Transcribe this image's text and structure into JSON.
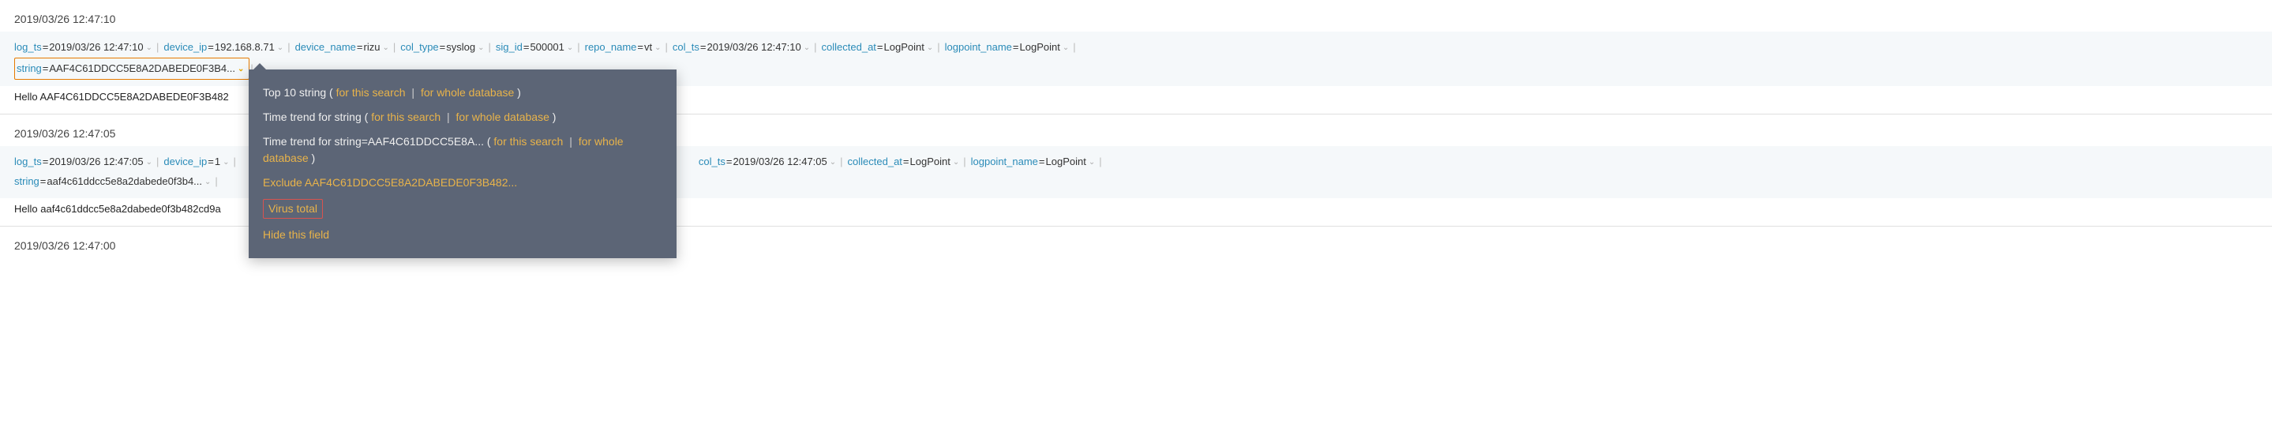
{
  "entries": [
    {
      "timestamp": "2019/03/26 12:47:10",
      "fields": [
        {
          "key": "log_ts",
          "val": "2019/03/26 12:47:10",
          "hl": false
        },
        {
          "key": "device_ip",
          "val": "192.168.8.71",
          "hl": false
        },
        {
          "key": "device_name",
          "val": "rizu",
          "hl": false
        },
        {
          "key": "col_type",
          "val": "syslog",
          "hl": false
        },
        {
          "key": "sig_id",
          "val": "500001",
          "hl": false
        },
        {
          "key": "repo_name",
          "val": "vt",
          "hl": false
        },
        {
          "key": "col_ts",
          "val": "2019/03/26 12:47:10",
          "hl": false
        },
        {
          "key": "collected_at",
          "val": "LogPoint",
          "hl": false
        },
        {
          "key": "logpoint_name",
          "val": "LogPoint",
          "hl": false
        },
        {
          "key": "string",
          "val": "AAF4C61DDCC5E8A2DABEDE0F3B4...",
          "hl": true,
          "break_before": true
        }
      ],
      "raw": "Hello AAF4C61DDCC5E8A2DABEDE0F3B482"
    },
    {
      "timestamp": "2019/03/26 12:47:05",
      "fields": [
        {
          "key": "log_ts",
          "val": "2019/03/26 12:47:05",
          "hl": false
        },
        {
          "key": "device_ip",
          "val": "1",
          "hl": false
        },
        {
          "key": "col_ts",
          "val": "2019/03/26 12:47:05",
          "hl": false,
          "gap_before": true
        },
        {
          "key": "collected_at",
          "val": "LogPoint",
          "hl": false
        },
        {
          "key": "logpoint_name",
          "val": "LogPoint",
          "hl": false
        },
        {
          "key": "string",
          "val": "aaf4c61ddcc5e8a2dabede0f3b4...",
          "hl": false,
          "break_before": true
        }
      ],
      "raw": "Hello aaf4c61ddcc5e8a2dabede0f3b482cd9a"
    },
    {
      "timestamp": "2019/03/26 12:47:00",
      "fields": [],
      "raw": ""
    }
  ],
  "menu": {
    "top10_prefix": "Top 10 string ( ",
    "for_this_search": "for this search",
    "for_whole_db": "for whole database",
    "close_paren": " )",
    "trend_prefix": "Time trend for string ( ",
    "trend_value_prefix": "Time trend for string=AAF4C61DDCC5E8A... ( ",
    "exclude": "Exclude AAF4C61DDCC5E8A2DABEDE0F3B482...",
    "virus_total": "Virus total",
    "hide_field": "Hide this field"
  }
}
